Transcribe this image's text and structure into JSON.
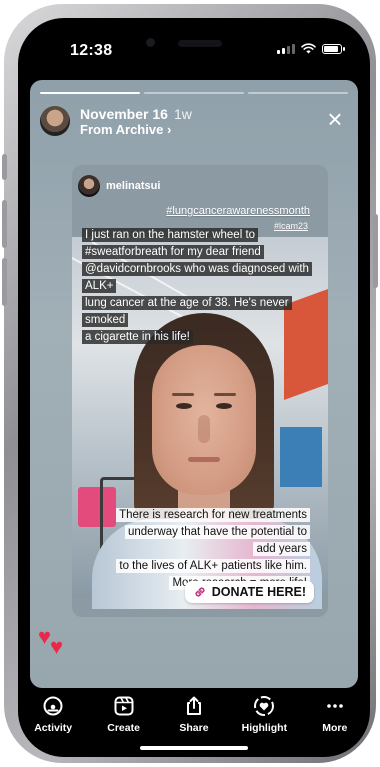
{
  "status_bar": {
    "time": "12:38"
  },
  "story": {
    "date": "November 16",
    "ago": "1w",
    "source": "From Archive",
    "archive_chevron": "›",
    "close_icon": "×",
    "progress": {
      "segments": 3,
      "current": 1
    }
  },
  "post": {
    "username": "melinatsui",
    "hashtag_main": "#lungcancerawarenessmonth",
    "hashtag_small": "#lcam23",
    "main_text_lines": [
      "I just ran on the hamster wheel to",
      "#sweatforbreath for my dear friend",
      "@davidcornbrooks who was diagnosed with ALK+",
      "lung cancer at the age of 38.  He's never smoked",
      "a cigarette in his life!"
    ],
    "secondary_text_lines": [
      "There is research for new treatments",
      "underway that have the potential to add years",
      "to the lives of ALK+ patients like him.",
      "More research = more life!"
    ],
    "donate_label": "DONATE HERE!"
  },
  "reactions": {
    "icon": "heart-icon",
    "count_shown": 2
  },
  "tabbar": {
    "items": [
      {
        "label": "Activity",
        "icon": "activity-icon"
      },
      {
        "label": "Create",
        "icon": "create-icon"
      },
      {
        "label": "Share",
        "icon": "share-icon"
      },
      {
        "label": "Highlight",
        "icon": "highlight-icon"
      },
      {
        "label": "More",
        "icon": "more-icon"
      }
    ]
  },
  "colors": {
    "accent_heart": "#e8294a",
    "story_bg": "#9eadb5",
    "link": "#c13584"
  }
}
